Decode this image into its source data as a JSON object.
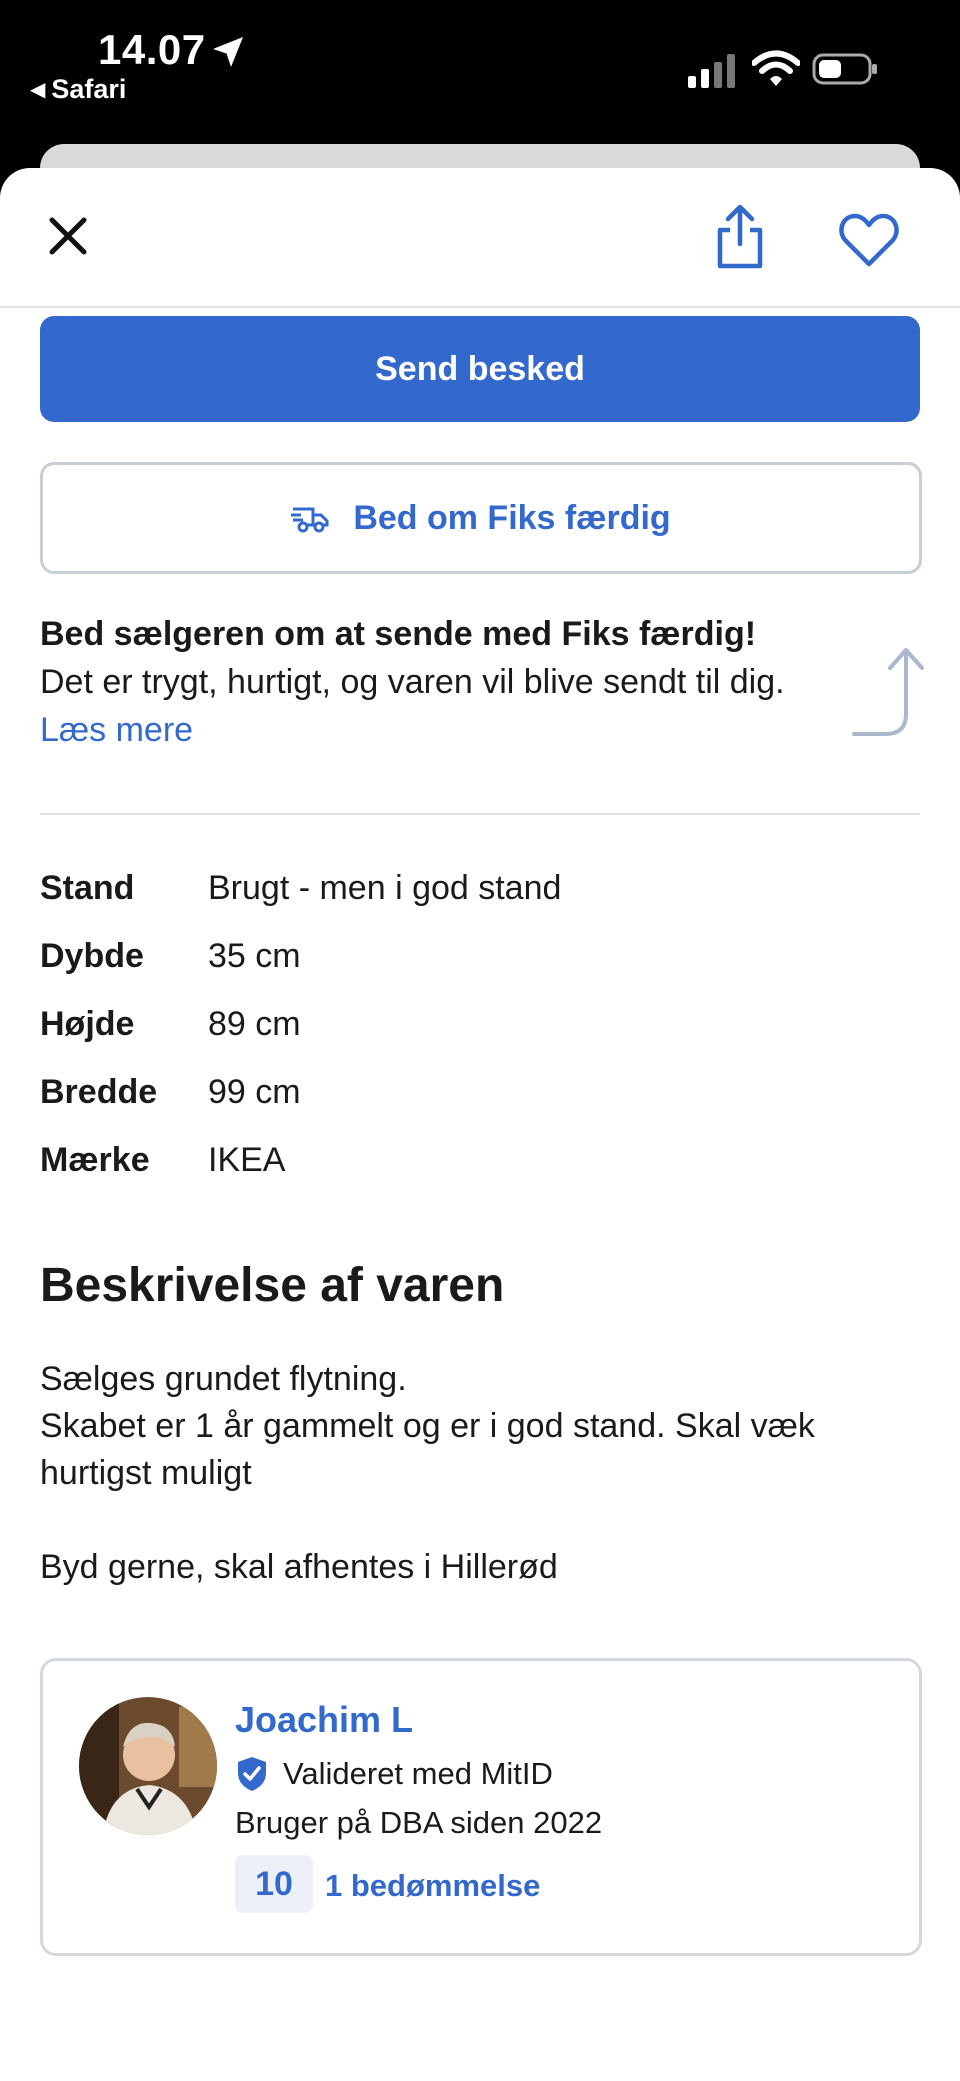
{
  "status_bar": {
    "time": "14.07",
    "back_app": "Safari"
  },
  "actions": {
    "send_message": "Send besked",
    "request_fiks": "Bed om Fiks færdig"
  },
  "promo": {
    "title": "Bed sælgeren om at sende med Fiks færdig!",
    "body": "Det er trygt, hurtigt, og varen vil blive sendt til dig.",
    "link": "Læs mere"
  },
  "specs": [
    {
      "label": "Stand",
      "value": "Brugt - men i god stand"
    },
    {
      "label": "Dybde",
      "value": "35 cm"
    },
    {
      "label": "Højde",
      "value": "89 cm"
    },
    {
      "label": "Bredde",
      "value": "99 cm"
    },
    {
      "label": "Mærke",
      "value": "IKEA"
    }
  ],
  "description": {
    "title": "Beskrivelse af varen",
    "line1": "Sælges grundet flytning.",
    "line2": "Skabet er 1 år gammelt og er i god stand. Skal væk hurtigst muligt",
    "line3": "Byd gerne, skal afhentes i Hillerød"
  },
  "seller": {
    "name": "Joachim L",
    "verified": "Valideret med MitID",
    "member_since": "Bruger på DBA siden 2022",
    "rating_score": "10",
    "rating_count": "1 bedømmelse"
  },
  "icons": [
    "close-icon",
    "share-icon",
    "heart-icon",
    "truck-icon",
    "curved-arrow-icon",
    "shield-check-icon",
    "location-arrow-icon",
    "signal-icon",
    "wifi-icon",
    "battery-icon"
  ],
  "colors": {
    "accent": "#3369cc",
    "border": "#c8cdd6",
    "text": "#1a1a1a"
  }
}
